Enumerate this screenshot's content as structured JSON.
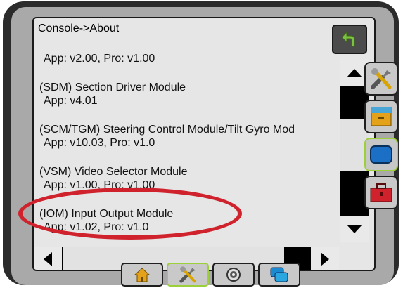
{
  "header": {
    "title": "Console->About"
  },
  "list": {
    "items": [
      {
        "name": "",
        "version": "App: v2.00, Pro: v1.00"
      },
      {
        "name": "(SDM) Section Driver Module",
        "version": "App: v4.01"
      },
      {
        "name": "(SCM/TGM) Steering Control Module/Tilt Gyro Mod",
        "version": "App: v10.03, Pro: v1.0"
      },
      {
        "name": "(VSM) Video Selector Module",
        "version": "App: v1.00, Pro: v1.00"
      },
      {
        "name": "(IOM) Input Output Module",
        "version": "App: v1.02, Pro: v1.0"
      }
    ]
  },
  "icons": {
    "back": "back-arrow-icon",
    "scroll_up": "triangle-up-icon",
    "scroll_down": "triangle-down-icon",
    "scroll_left": "triangle-left-icon",
    "scroll_right": "triangle-right-icon",
    "side_tools": "tools-icon",
    "side_cabinet": "file-cabinet-icon",
    "side_display": "display-icon",
    "side_toolbox": "toolbox-icon",
    "nav_home": "home-icon",
    "nav_tools": "tools-icon",
    "nav_camera": "camera-icon",
    "nav_screens": "screens-icon"
  },
  "colors": {
    "highlight": "#d0222c",
    "active_border": "#9ccf3a",
    "back_arrow": "#7cc242"
  }
}
